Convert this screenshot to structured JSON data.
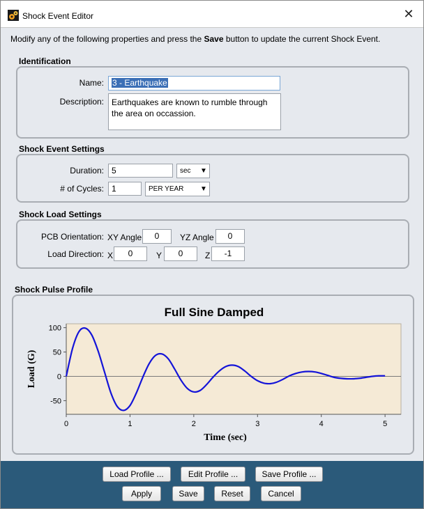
{
  "window": {
    "title": "Shock Event Editor",
    "close_glyph": "✕"
  },
  "instructions": {
    "before": "Modify any of the following properties and press the ",
    "bold": "Save",
    "after": " button to update the current Shock Event."
  },
  "identification": {
    "title": "Identification",
    "name_label": "Name:",
    "name_value": "3 - Earthquake",
    "description_label": "Description:",
    "description_value": "Earthquakes are known to rumble through the area on occassion."
  },
  "event_settings": {
    "title": "Shock Event Settings",
    "duration_label": "Duration:",
    "duration_value": "5",
    "duration_unit": "sec",
    "cycles_label": "# of Cycles:",
    "cycles_value": "1",
    "cycles_unit": "PER YEAR"
  },
  "load_settings": {
    "title": "Shock Load Settings",
    "orientation_label": "PCB Orientation:",
    "xy_label": "XY Angle",
    "xy_value": "0",
    "yz_label": "YZ Angle",
    "yz_value": "0",
    "direction_label": "Load Direction:",
    "x_label": "X",
    "x_value": "0",
    "y_label": "Y",
    "y_value": "0",
    "z_label": "Z",
    "z_value": "-1"
  },
  "pulse_profile": {
    "title": "Shock Pulse Profile"
  },
  "chart_data": {
    "type": "line",
    "title": "Full Sine Damped",
    "xlabel": "Time (sec)",
    "ylabel": "Load (G)",
    "xlim": [
      0,
      5.25
    ],
    "ylim": [
      -78,
      108
    ],
    "xticks": [
      0,
      1,
      2,
      3,
      4,
      5
    ],
    "yticks": [
      100,
      50,
      0,
      -50
    ],
    "grid": false,
    "background": "#f5ead6",
    "line_color": "#1414d8",
    "series": [
      {
        "x": [
          0,
          0.1,
          0.2,
          0.3,
          0.4,
          0.5,
          0.6,
          0.7,
          0.8,
          0.9,
          1.0,
          1.1,
          1.2,
          1.3,
          1.4,
          1.5,
          1.6,
          1.7,
          1.8,
          1.9,
          2.0,
          2.1,
          2.2,
          2.3,
          2.4,
          2.5,
          2.6,
          2.7,
          2.8,
          2.9,
          3.0,
          3.1,
          3.2,
          3.3,
          3.4,
          3.5,
          3.6,
          3.7,
          3.8,
          3.9,
          4.0,
          4.1,
          4.2,
          4.3,
          4.4,
          4.5,
          4.6,
          4.7,
          4.8,
          4.9,
          5.0
        ],
        "values": [
          0,
          58,
          92,
          99,
          85,
          52,
          9,
          -34,
          -62,
          -70,
          -60,
          -34,
          -2,
          26,
          43,
          46,
          36,
          15,
          -8,
          -25,
          -32,
          -29,
          -17,
          -2,
          11,
          20,
          23,
          20,
          11,
          0,
          -9,
          -14,
          -15,
          -12,
          -6,
          1,
          6,
          9,
          10,
          9,
          6,
          2,
          -2,
          -4,
          -5,
          -5,
          -4,
          -2,
          0,
          1,
          1
        ]
      }
    ]
  },
  "buttons": {
    "load_profile": "Load Profile ...",
    "edit_profile": "Edit Profile ...",
    "save_profile": "Save Profile ...",
    "apply": "Apply",
    "save": "Save",
    "reset": "Reset",
    "cancel": "Cancel"
  },
  "colors": {
    "footer": "#2b5a7a",
    "selection": "#3b6fb6"
  }
}
